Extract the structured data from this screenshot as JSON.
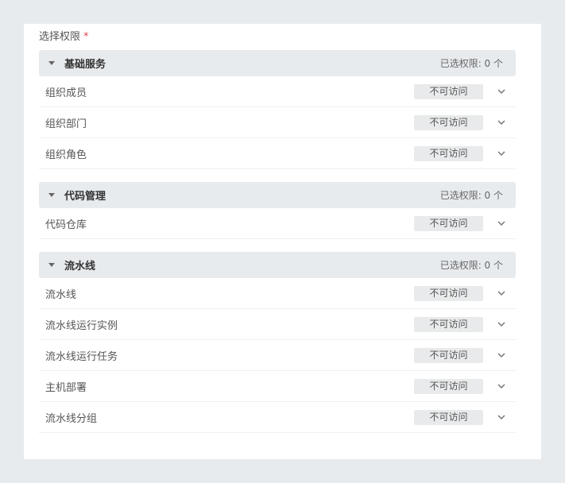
{
  "form": {
    "label": "选择权限",
    "required_mark": "*"
  },
  "groups": [
    {
      "title": "基础服务",
      "selected_text": "已选权限: 0 个",
      "items": [
        {
          "label": "组织成员",
          "access": "不可访问"
        },
        {
          "label": "组织部门",
          "access": "不可访问"
        },
        {
          "label": "组织角色",
          "access": "不可访问"
        }
      ]
    },
    {
      "title": "代码管理",
      "selected_text": "已选权限: 0 个",
      "items": [
        {
          "label": "代码仓库",
          "access": "不可访问"
        }
      ]
    },
    {
      "title": "流水线",
      "selected_text": "已选权限: 0 个",
      "items": [
        {
          "label": "流水线",
          "access": "不可访问"
        },
        {
          "label": "流水线运行实例",
          "access": "不可访问"
        },
        {
          "label": "流水线运行任务",
          "access": "不可访问"
        },
        {
          "label": "主机部署",
          "access": "不可访问"
        },
        {
          "label": "流水线分组",
          "access": "不可访问"
        }
      ]
    }
  ],
  "icons": {
    "group_caret": "caret-down-icon",
    "row_toggle": "chevron-down-icon"
  }
}
